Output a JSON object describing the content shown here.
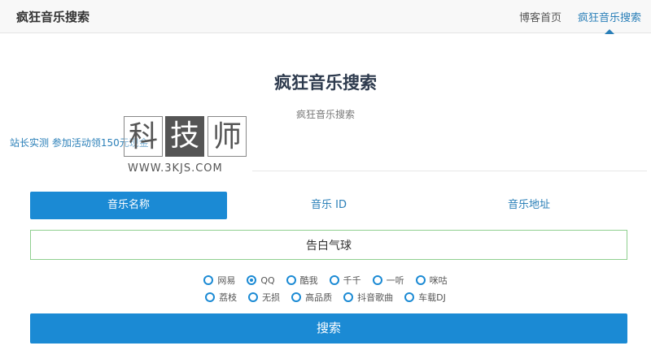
{
  "header": {
    "brand": "疯狂音乐搜索",
    "nav": [
      {
        "label": "博客首页",
        "active": false
      },
      {
        "label": "疯狂音乐搜索",
        "active": true
      }
    ]
  },
  "main": {
    "title": "疯狂音乐搜索",
    "subtitle": "疯狂音乐搜索",
    "promo_link": "站长实测 参加活动领150元现金",
    "watermark": {
      "chars": [
        "科",
        "技",
        "师"
      ],
      "url": "WWW.3KJS.COM"
    },
    "tabs": [
      {
        "label": "音乐名称",
        "active": true
      },
      {
        "label": "音乐 ID",
        "active": false
      },
      {
        "label": "音乐地址",
        "active": false
      }
    ],
    "search_value": "告白气球",
    "sources_row1": [
      {
        "label": "网易",
        "checked": false
      },
      {
        "label": "QQ",
        "checked": true
      },
      {
        "label": "酷我",
        "checked": false
      },
      {
        "label": "千千",
        "checked": false
      },
      {
        "label": "一听",
        "checked": false
      },
      {
        "label": "咪咕",
        "checked": false
      }
    ],
    "sources_row2": [
      {
        "label": "荔枝",
        "checked": false
      },
      {
        "label": "无损",
        "checked": false
      },
      {
        "label": "高品质",
        "checked": false
      },
      {
        "label": "抖音歌曲",
        "checked": false
      },
      {
        "label": "车载DJ",
        "checked": false
      }
    ],
    "search_button": "搜索"
  },
  "colors": {
    "accent": "#1b8ad4",
    "link": "#2a7fb8",
    "input_border": "#8fcf8f"
  }
}
